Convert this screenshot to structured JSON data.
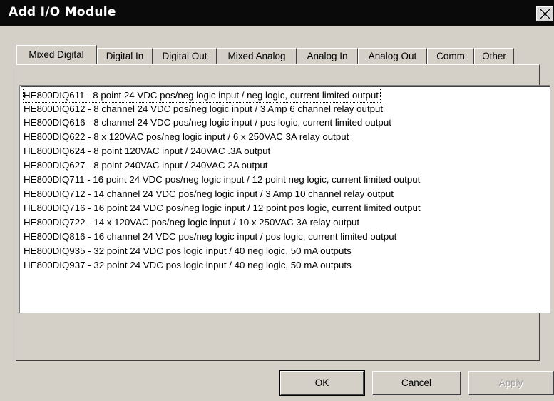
{
  "window": {
    "title": "Add I/O Module"
  },
  "tabs": [
    {
      "label": "Mixed Digital",
      "active": true
    },
    {
      "label": "Digital In"
    },
    {
      "label": "Digital Out"
    },
    {
      "label": "Mixed Analog"
    },
    {
      "label": "Analog In"
    },
    {
      "label": "Analog Out"
    },
    {
      "label": "Comm"
    },
    {
      "label": "Other"
    }
  ],
  "modules": [
    "HE800DIQ611  -  8 point 24 VDC pos/neg logic input / neg logic, current limited output",
    "HE800DIQ612  -  8 channel 24 VDC pos/neg logic input / 3 Amp 6 channel relay output",
    "HE800DIQ616  -  8 channel 24 VDC pos/neg logic input / pos logic, current limited output",
    "HE800DIQ622  -  8 x 120VAC pos/neg logic input / 6 x 250VAC 3A relay output",
    "HE800DIQ624  -  8 point 120VAC input / 240VAC .3A output",
    "HE800DIQ627  -  8 point 240VAC input / 240VAC 2A output",
    "HE800DIQ711  -  16 point 24 VDC pos/neg logic input / 12 point neg logic, current limited output",
    "HE800DIQ712  -  14 channel 24 VDC pos/neg logic input / 3 Amp 10 channel relay output",
    "HE800DIQ716  -  16 point 24 VDC pos/neg logic input / 12 point pos logic, current limited output",
    "HE800DIQ722  -  14 x 120VAC pos/neg logic input / 10 x 250VAC 3A relay output",
    "HE800DIQ816  -  16 channel 24 VDC pos/neg logic input / pos logic, current limited output",
    "HE800DIQ935  -  32 point 24 VDC pos logic input / 40 neg logic, 50 mA outputs",
    "HE800DIQ937  -  32 point 24 VDC pos logic input / 40 neg logic, 50 mA outputs"
  ],
  "buttons": {
    "ok": "OK",
    "cancel": "Cancel",
    "apply": "Apply"
  },
  "icons": {
    "close": "close-icon"
  },
  "colors": {
    "titlebar": "#0a0a0a",
    "dialog": "#d4d0c8",
    "list": "#ffffff"
  }
}
